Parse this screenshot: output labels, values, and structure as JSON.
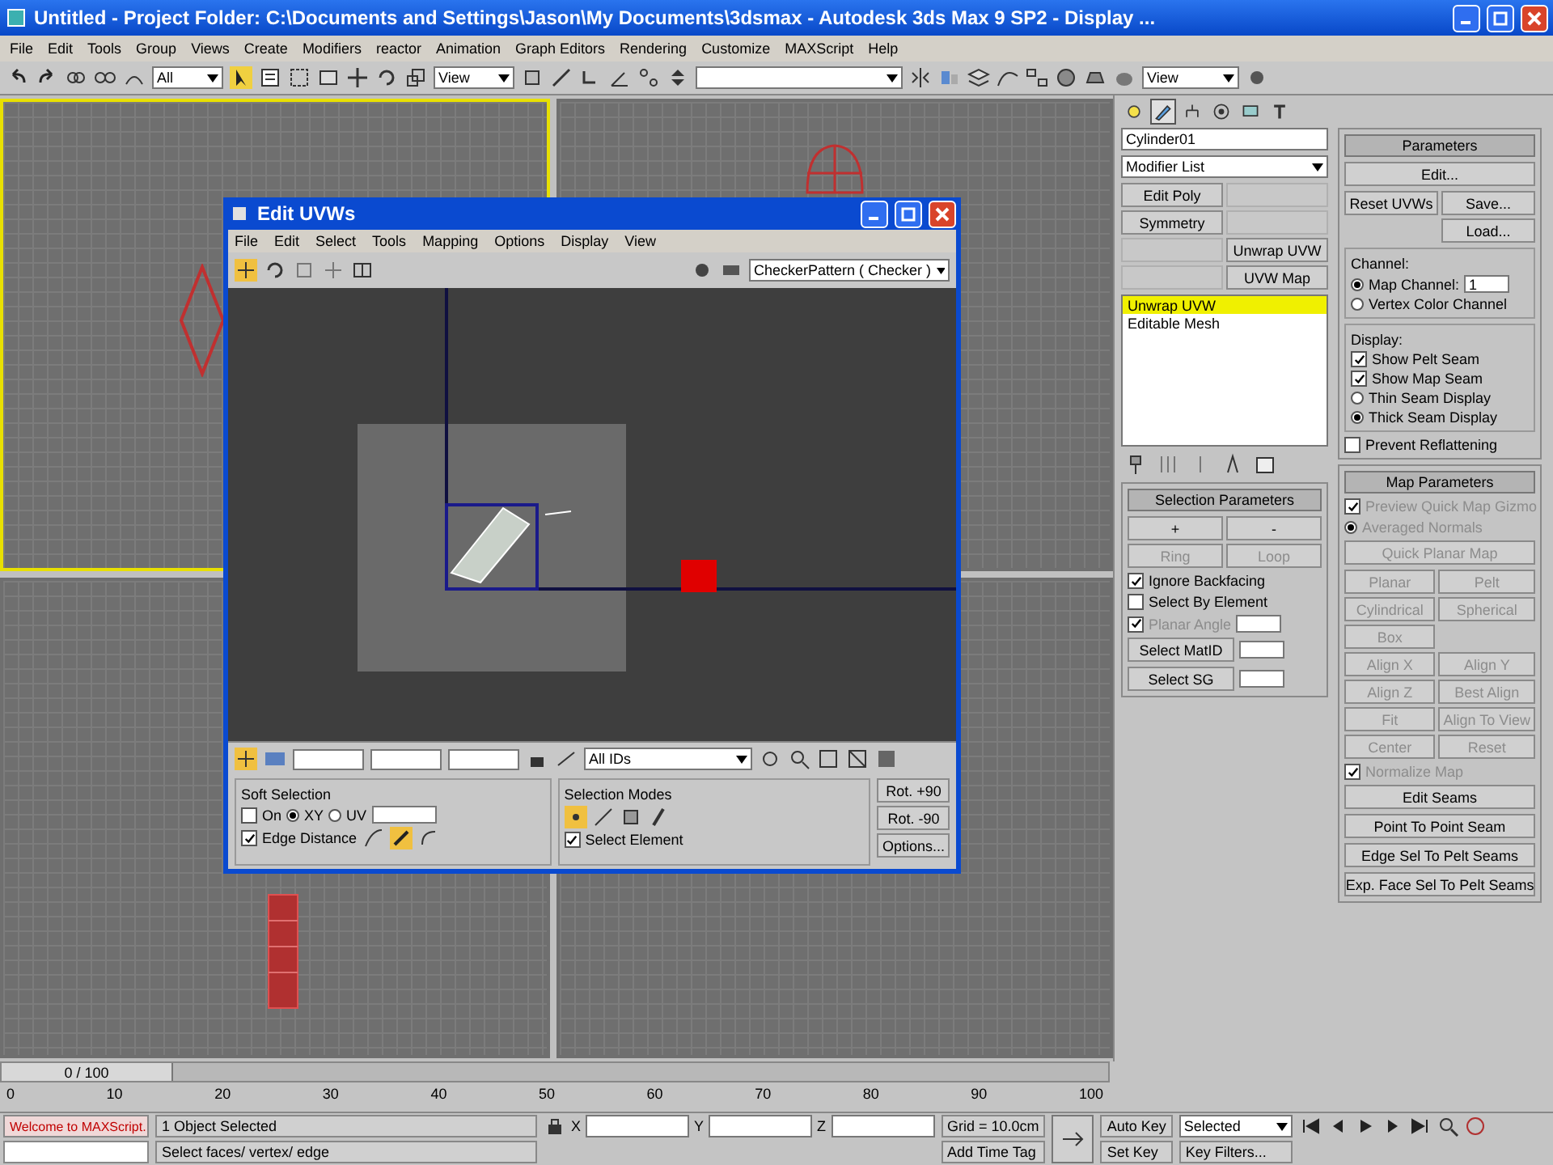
{
  "window": {
    "title": "Untitled   - Project Folder: C:\\Documents and Settings\\Jason\\My Documents\\3dsmax   - Autodesk 3ds Max 9 SP2   - Display ..."
  },
  "menu": [
    "File",
    "Edit",
    "Tools",
    "Group",
    "Views",
    "Create",
    "Modifiers",
    "reactor",
    "Animation",
    "Graph Editors",
    "Rendering",
    "Customize",
    "MAXScript",
    "Help"
  ],
  "toolbar": {
    "selection_filter": "All",
    "reference_coordinate": "View",
    "named_selection": "View"
  },
  "viewports": [
    {
      "active": true
    },
    {
      "active": false
    },
    {
      "active": false
    },
    {
      "active": false
    }
  ],
  "uv_editor": {
    "title": "Edit UVWs",
    "menu": [
      "File",
      "Edit",
      "Select",
      "Tools",
      "Mapping",
      "Options",
      "Display",
      "View"
    ],
    "texture_dropdown": "CheckerPattern ( Checker )",
    "id_dropdown": "All IDs",
    "soft_selection": {
      "title": "Soft Selection",
      "on": {
        "label": "On",
        "checked": false
      },
      "falloff": [
        {
          "label": "XY",
          "selected": true
        },
        {
          "label": "UV",
          "selected": false
        }
      ],
      "edge_distance": {
        "label": "Edge Distance",
        "checked": true
      }
    },
    "selection_modes": {
      "title": "Selection Modes",
      "select_element": {
        "label": "Select Element",
        "checked": true
      }
    },
    "buttons": [
      "Rot. +90",
      "Rot. -90",
      "Options..."
    ]
  },
  "command_panel": {
    "tabs": [
      {
        "kind": "create",
        "selected": false
      },
      {
        "kind": "modify",
        "selected": true
      },
      {
        "kind": "hierarchy",
        "selected": false
      },
      {
        "kind": "motion",
        "selected": false
      },
      {
        "kind": "display",
        "selected": false
      },
      {
        "kind": "utilities",
        "selected": false
      }
    ],
    "object_name": "Cylinder01",
    "modifier_list": "Modifier List",
    "modifier_buttons": [
      {
        "kind": "button",
        "label": "Edit Poly"
      },
      {
        "kind": "blank"
      },
      {
        "kind": "button",
        "label": "Symmetry"
      },
      {
        "kind": "blank"
      },
      {
        "kind": "blank"
      },
      {
        "kind": "button",
        "label": "Unwrap UVW"
      },
      {
        "kind": "blank"
      },
      {
        "kind": "button",
        "label": "UVW Map"
      }
    ],
    "stack": [
      {
        "label": "Unwrap UVW",
        "selected": true
      },
      {
        "label": "Editable Mesh",
        "selected": false
      }
    ],
    "parameters": {
      "title": "Parameters",
      "edit": "Edit...",
      "reset": "Reset UVWs",
      "save": "Save...",
      "load": "Load...",
      "channel_title": "Channel:",
      "channels": [
        {
          "label": "Map Channel:",
          "selected": true
        },
        {
          "label": "Vertex Color Channel",
          "selected": false
        }
      ],
      "map_channel_value": "1",
      "display_title": "Display:",
      "display_checks": [
        {
          "label": "Show Pelt Seam",
          "checked": true
        },
        {
          "label": "Show Map Seam",
          "checked": true
        }
      ],
      "seam_display": [
        {
          "label": "Thin Seam Display",
          "selected": false
        },
        {
          "label": "Thick Seam Display",
          "selected": true
        }
      ],
      "prevent": {
        "label": "Prevent Reflattening",
        "checked": false
      }
    },
    "selection_parameters": {
      "title": "Selection Parameters",
      "buttons": [
        {
          "label": "+",
          "disabled": false
        },
        {
          "label": "-",
          "disabled": false
        },
        {
          "label": "Ring",
          "disabled": true
        },
        {
          "label": "Loop",
          "disabled": true
        }
      ],
      "checks": [
        {
          "label": "Ignore Backfacing",
          "checked": true,
          "disabled": false
        },
        {
          "label": "Select By Element",
          "checked": false,
          "disabled": false
        },
        {
          "label": "Planar Angle",
          "checked": true,
          "disabled": true
        }
      ],
      "matid": "Select MatID",
      "sg": "Select SG"
    },
    "map_parameters": {
      "title": "Map Parameters",
      "preview": {
        "label": "Preview Quick Map Gizmo",
        "checked": true
      },
      "averaged": {
        "label": "Averaged Normals",
        "selected": true
      },
      "quick_planar": "Quick Planar Map",
      "buttons": [
        "Planar",
        "Pelt",
        "Cylindrical",
        "Spherical",
        "Box",
        "Align X",
        "Align Y",
        "Align Z",
        "Best Align",
        "Fit",
        "Align To View",
        "Center",
        "Reset"
      ],
      "normalize": {
        "label": "Normalize Map",
        "checked": true
      },
      "seam_buttons": [
        "Edit Seams",
        "Point To Point Seam",
        "Edge Sel To Pelt Seams",
        "Exp. Face Sel To Pelt Seams"
      ]
    }
  },
  "timeline": {
    "frame": "0 / 100",
    "level": 0,
    "ticks": [
      "0",
      "10",
      "20",
      "30",
      "40",
      "50",
      "60",
      "70",
      "80",
      "90",
      "100"
    ]
  },
  "status_bar": {
    "maxscript": "Welcome to MAXScript.",
    "selection": "1 Object Selected",
    "prompt": "Select faces/ vertex/ edge",
    "axes": [
      "X",
      "Y",
      "Z"
    ],
    "grid": "Grid = 10.0cm",
    "time_tag": "Add Time Tag",
    "auto_key": "Auto Key",
    "key_mode": "Selected",
    "set_key": "Set Key",
    "key_filters": "Key Filters..."
  }
}
